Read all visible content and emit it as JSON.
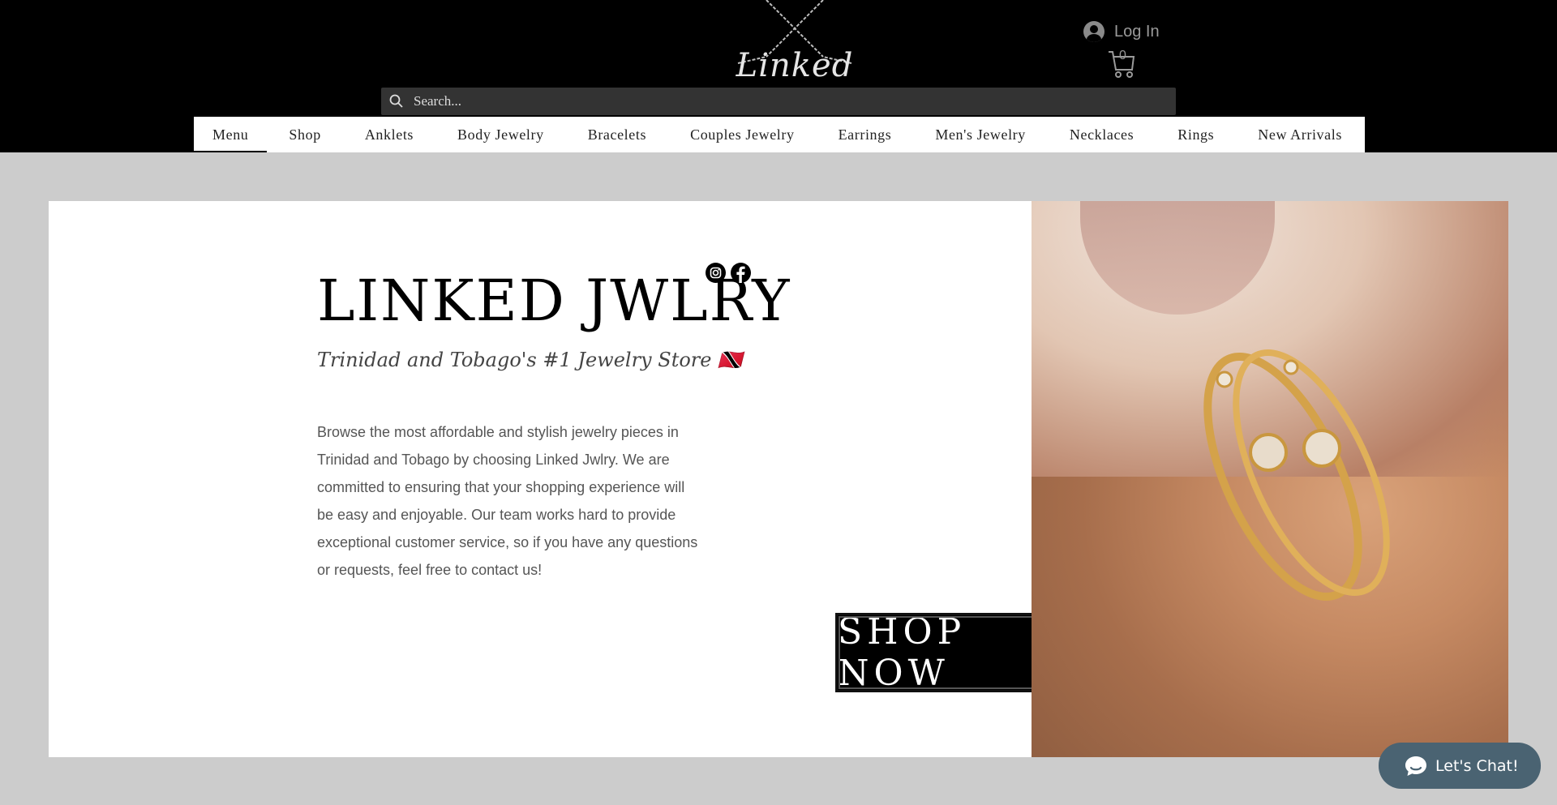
{
  "header": {
    "logo_text": "Linked",
    "login_label": "Log In",
    "cart_count": "0",
    "search_placeholder": "Search..."
  },
  "nav": {
    "items": [
      {
        "label": "Menu"
      },
      {
        "label": "Shop"
      },
      {
        "label": "Anklets"
      },
      {
        "label": "Body Jewelry"
      },
      {
        "label": "Bracelets"
      },
      {
        "label": "Couples Jewelry"
      },
      {
        "label": "Earrings"
      },
      {
        "label": "Men's Jewelry"
      },
      {
        "label": "Necklaces"
      },
      {
        "label": "Rings"
      },
      {
        "label": "New Arrivals"
      }
    ]
  },
  "hero": {
    "title": "LINKED JWLRY",
    "subtitle": "Trinidad and Tobago's #1 Jewelry Store 🇹🇹",
    "description": "Browse the most affordable and stylish jewelry pieces in Trinidad and Tobago by choosing Linked Jwlry. We are committed to ensuring that your shopping experience will be easy and enjoyable. Our team works hard to provide exceptional customer service, so if you have any questions or requests, feel free to contact us!",
    "cta_label": "SHOP NOW",
    "social_icons": [
      "instagram-icon",
      "facebook-icon"
    ]
  },
  "chat": {
    "label": "Let's Chat!"
  },
  "colors": {
    "header_bg": "#000000",
    "page_bg": "#cccccc",
    "chat_bg": "#4a6372"
  }
}
